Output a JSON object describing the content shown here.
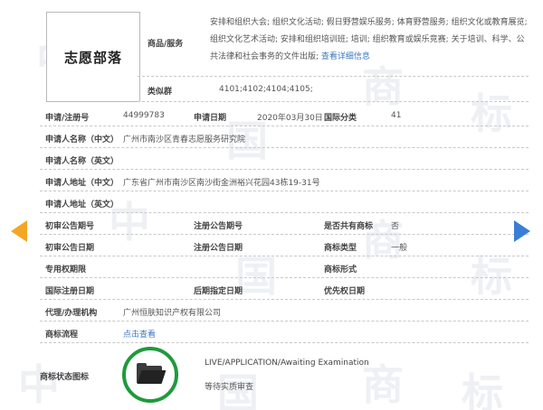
{
  "watermark": [
    "中",
    "国",
    "商",
    "标",
    "中",
    "国",
    "商",
    "标",
    "中",
    "国",
    "商",
    "标"
  ],
  "trademark": {
    "name": "志愿部落"
  },
  "goods": {
    "label": "商品/服务",
    "text": "安排和组织大会; 组织文化活动; 假日野营娱乐服务; 体育野营服务; 组织文化或教育展览; 组织文化艺术活动; 安排和组织培训班; 培训; 组织教育或娱乐竞赛; 关于培训、科学、公共法律和社会事务的文件出版; ",
    "link": "查看详细信息"
  },
  "similar_group": {
    "label": "类似群",
    "value": "4101;4102;4104;4105;"
  },
  "reg": {
    "number_label": "申请/注册号",
    "number_value": "44999783",
    "date_label": "申请日期",
    "date_value": "2020年03月30日",
    "intl_label": "国际分类",
    "intl_value": "41"
  },
  "applicant_cn": {
    "label": "申请人名称（中文）",
    "value": "广州市南沙区青春志愿服务研究院"
  },
  "applicant_en": {
    "label": "申请人名称（英文）",
    "value": ""
  },
  "address_cn": {
    "label": "申请人地址（中文）",
    "value": "广东省广州市南沙区南沙街金洲裕兴花园43栋19-31号"
  },
  "address_en": {
    "label": "申请人地址（英文）",
    "value": ""
  },
  "prelim": {
    "pub_no_label": "初审公告期号",
    "pub_no_value": "",
    "reg_no_label": "注册公告期号",
    "reg_no_value": "",
    "shared_label": "是否共有商标",
    "shared_value": "否"
  },
  "prelim_date": {
    "pub_date_label": "初审公告日期",
    "pub_date_value": "",
    "reg_date_label": "注册公告日期",
    "reg_date_value": "",
    "type_label": "商标类型",
    "type_value": "一般"
  },
  "exclusive": {
    "label": "专用权期限",
    "value": "",
    "form_label": "商标形式",
    "form_value": ""
  },
  "intl_reg": {
    "date_label": "国际注册日期",
    "date_value": "",
    "later_label": "后期指定日期",
    "later_value": "",
    "priority_label": "优先权日期",
    "priority_value": ""
  },
  "agent": {
    "label": "代理/办理机构",
    "value": "广州恒肤知识产权有限公司"
  },
  "flow": {
    "label": "商标流程",
    "link": "点击查看"
  },
  "status": {
    "label": "商标状态图标",
    "icon": "folder-icon",
    "english": "LIVE/APPLICATION/Awaiting Examination",
    "chinese": "等待实质审查"
  },
  "colors": {
    "accent": "#3a78c3",
    "status_ring": "#1f9a3c",
    "arrow_left": "#f5a623",
    "arrow_right": "#3a7fd5"
  }
}
